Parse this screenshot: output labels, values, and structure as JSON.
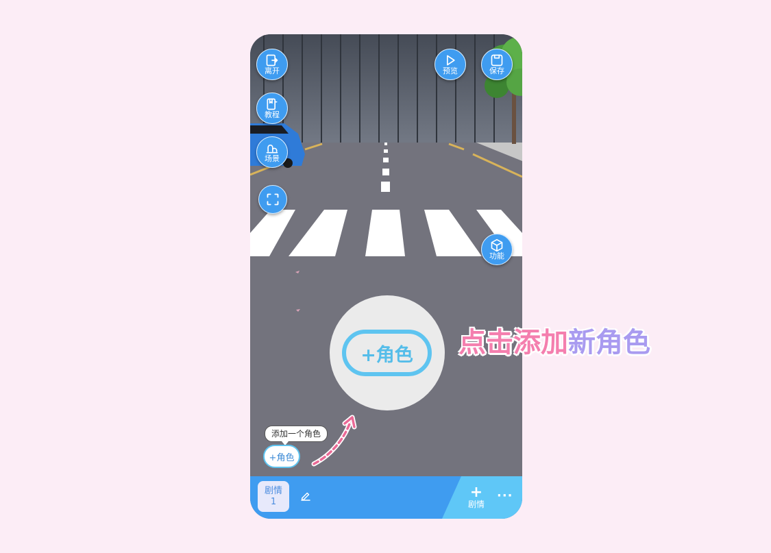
{
  "top_left": {
    "leave_label": "离开",
    "tutorial_label": "教程",
    "scene_label": "场景",
    "fullscreen_icon": "fullscreen-icon"
  },
  "top_right": {
    "preview_label": "预览",
    "save_label": "保存"
  },
  "function_label": "功能",
  "highlight": {
    "add_role_label": "+角色"
  },
  "hint": {
    "part1": "点击添加",
    "part2": "新角色",
    "colors": [
      "#f47fae",
      "#a99bf0"
    ]
  },
  "tooltip": "添加一个角色",
  "small_add_role_label": "+角色",
  "bottom_bar": {
    "tab_label": "剧情",
    "tab_number": "1",
    "add_plot_label": "剧情",
    "more_label": "···"
  },
  "colors": {
    "button_blue": "#3f9cf0",
    "accent_cyan": "#5ec4f0",
    "background": "#fcedf6"
  }
}
